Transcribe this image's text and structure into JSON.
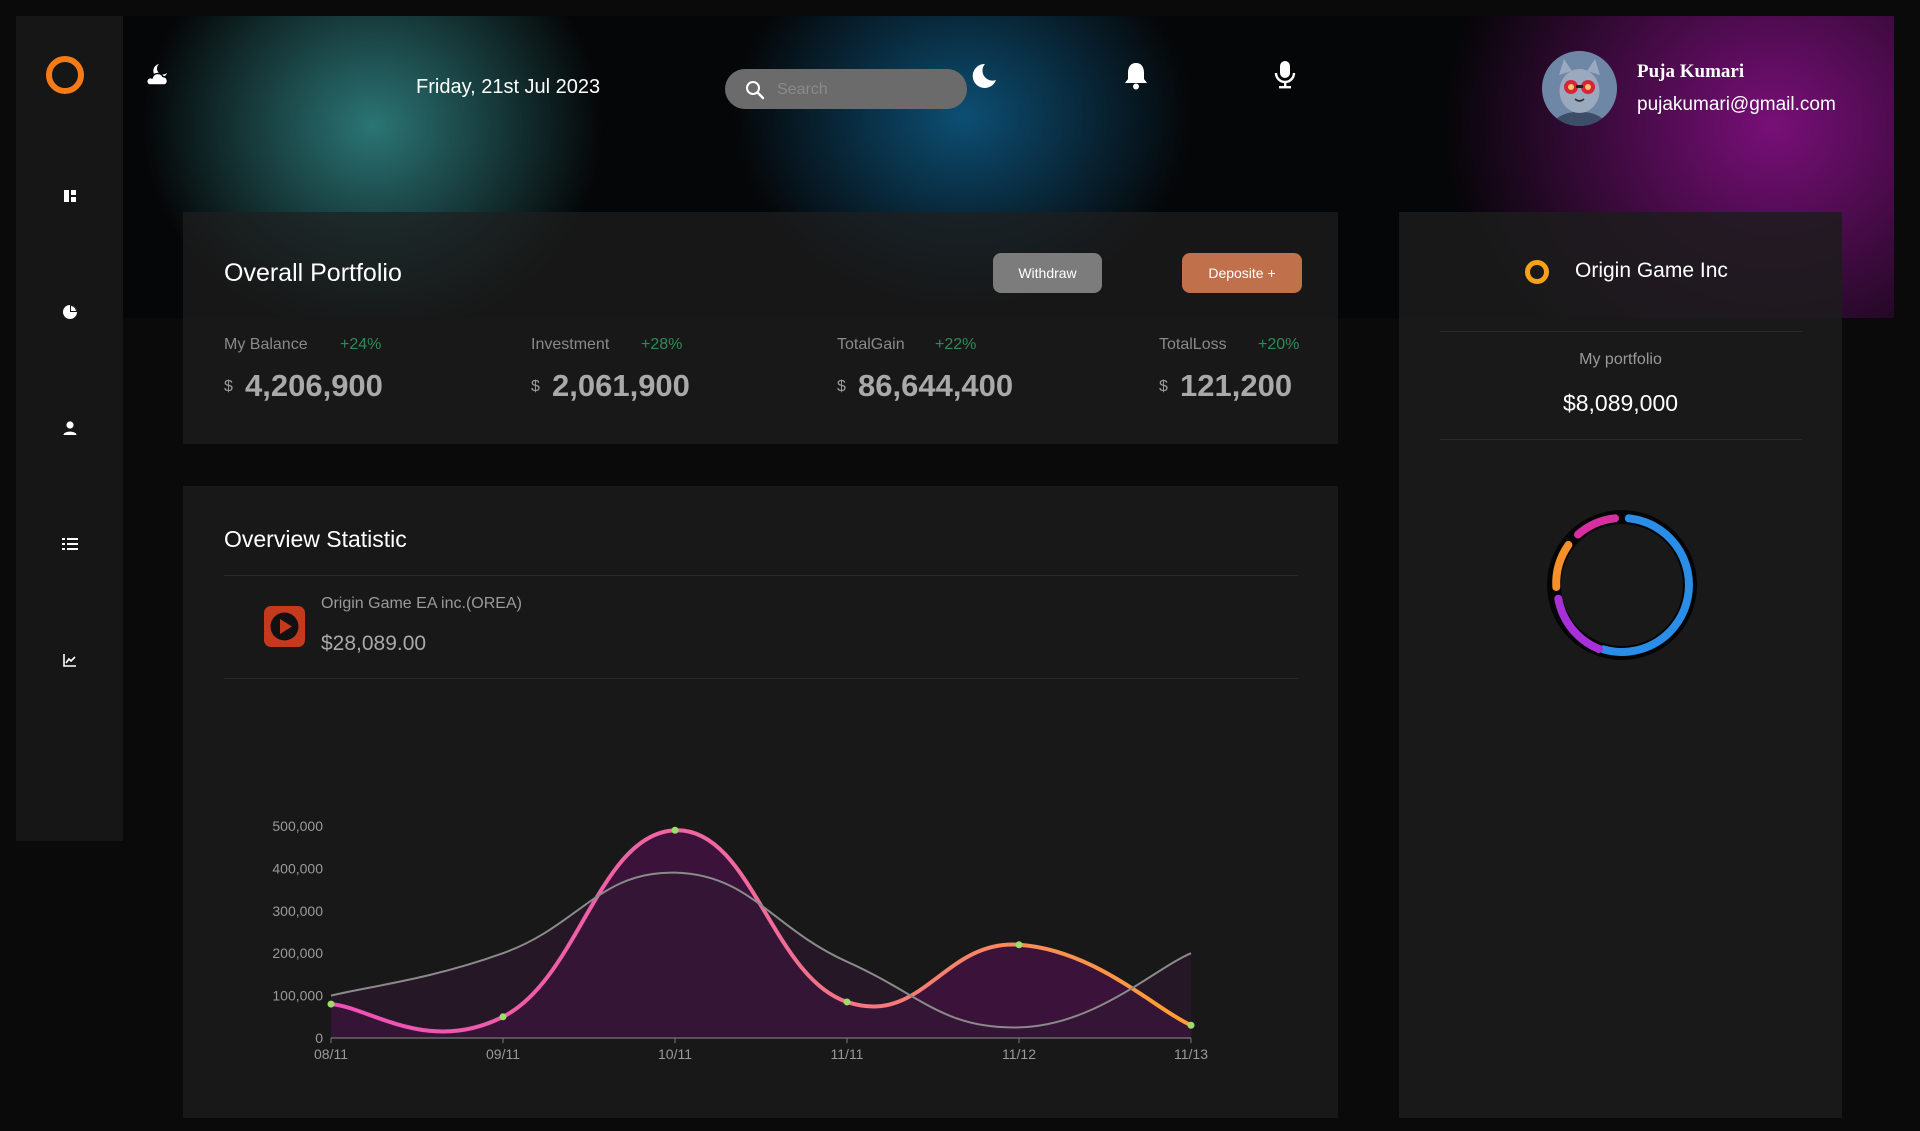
{
  "header": {
    "date": "Friday, 21st Jul 2023",
    "search_placeholder": "Search",
    "user": {
      "name": "Puja Kumari",
      "email": "pujakumari@gmail.com"
    }
  },
  "sidebar": {
    "items": [
      {
        "icon": "dashboard-icon"
      },
      {
        "icon": "pie-chart-icon"
      },
      {
        "icon": "user-icon"
      },
      {
        "icon": "list-icon"
      },
      {
        "icon": "line-chart-icon"
      }
    ]
  },
  "portfolio": {
    "title": "Overall Portfolio",
    "withdraw_label": "Withdraw",
    "deposit_label": "Deposite +",
    "stats": [
      {
        "label": "My Balance",
        "change": "+24%",
        "currency": "$",
        "value": "4,206,900"
      },
      {
        "label": "Investment",
        "change": "+28%",
        "currency": "$",
        "value": "2,061,900"
      },
      {
        "label": "TotalGain",
        "change": "+22%",
        "currency": "$",
        "value": "86,644,400"
      },
      {
        "label": "TotalLoss",
        "change": "+20%",
        "currency": "$",
        "value": "121,200"
      }
    ]
  },
  "overview": {
    "title": "Overview Statistic",
    "asset_name": "Origin Game EA inc.(OREA)",
    "asset_price": "$28,089.00"
  },
  "right_panel": {
    "company": "Origin Game Inc",
    "portfolio_label": "My portfolio",
    "portfolio_value": "$8,089,000"
  },
  "colors": {
    "accent_orange": "#f57b18",
    "deposit_button": "#c0704a",
    "withdraw_button": "#7c7c7c",
    "positive_change": "#2e8b57"
  },
  "chart_data": {
    "type": "line",
    "categories": [
      "08/11",
      "09/11",
      "10/11",
      "11/11",
      "11/12",
      "11/13"
    ],
    "series": [
      {
        "values": [
          80000,
          50000,
          490000,
          85000,
          220000,
          30000
        ]
      },
      {
        "values": [
          100000,
          200000,
          390000,
          180000,
          25000,
          200000
        ]
      }
    ],
    "yticks": [
      "0",
      "100,000",
      "200,000",
      "300,000",
      "400,000",
      "500,000"
    ],
    "ylim": [
      0,
      500000
    ],
    "grid": false,
    "legend": false
  }
}
